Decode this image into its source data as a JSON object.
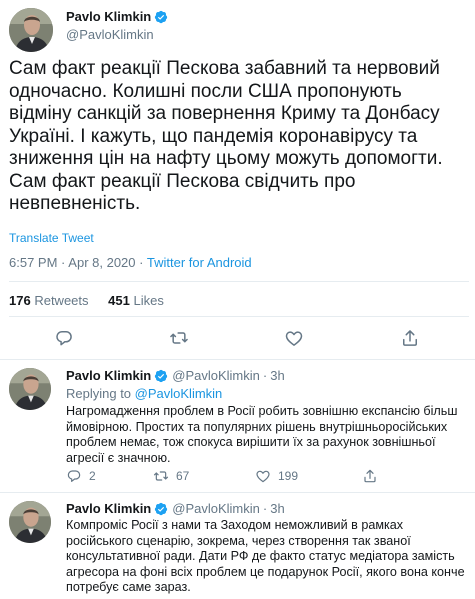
{
  "main_tweet": {
    "display_name": "Pavlo Klimkin",
    "handle": "@PavloKlimkin",
    "text": "Сам факт реакції Пескова забавний та нервовий\nодночасно. Колишні посли США пропонують\nвідміну санкцій за повернення Криму та Донбасу\nУкраїні. І кажуть, що пандемія коронавірусу та\nзниження цін на нафту цьому можуть допомогти.\nСам факт реакції Пескова свідчить про\nневпевненість.",
    "translate_label": "Translate Tweet",
    "time": "6:57 PM",
    "separator": "·",
    "date": "Apr 8, 2020",
    "source": "Twitter for Android",
    "retweets_count": "176",
    "retweets_label": "Retweets",
    "likes_count": "451",
    "likes_label": "Likes"
  },
  "replies": [
    {
      "display_name": "Pavlo Klimkin",
      "handle": "@PavloKlimkin",
      "dot": "·",
      "time_ago": "3h",
      "replying_to_label": "Replying to",
      "replying_to_handle": "@PavloKlimkin",
      "text": "Нагромадження проблем в Росії робить зовнішню експансію більш\nймовірною. Простих та популярних рішень внутрішньоросійських\nпроблем немає, тож спокуса вирішити їх за рахунок зовнішньої\nагресії є значною.",
      "reply_count": "2",
      "retweet_count": "67",
      "like_count": "199"
    },
    {
      "display_name": "Pavlo Klimkin",
      "handle": "@PavloKlimkin",
      "dot": "·",
      "time_ago": "3h",
      "text": "Компроміс Росії з нами та Заходом неможливий в рамках\nросійського сценарію, зокрема, через створення так званої\nконсультативної ради. Дати РФ де факто статус медіатора замість\nагресора на фоні всіх проблем це подарунок Росії, якого вона конче\nпотребує саме зараз."
    }
  ],
  "colors": {
    "accent": "#1b95e0",
    "verified": "#1da1f2",
    "muted": "#657786",
    "text": "#14171a",
    "divider": "#e6ecf0"
  },
  "icons": [
    "verified-badge-icon",
    "reply-icon",
    "retweet-icon",
    "like-icon",
    "share-icon"
  ]
}
